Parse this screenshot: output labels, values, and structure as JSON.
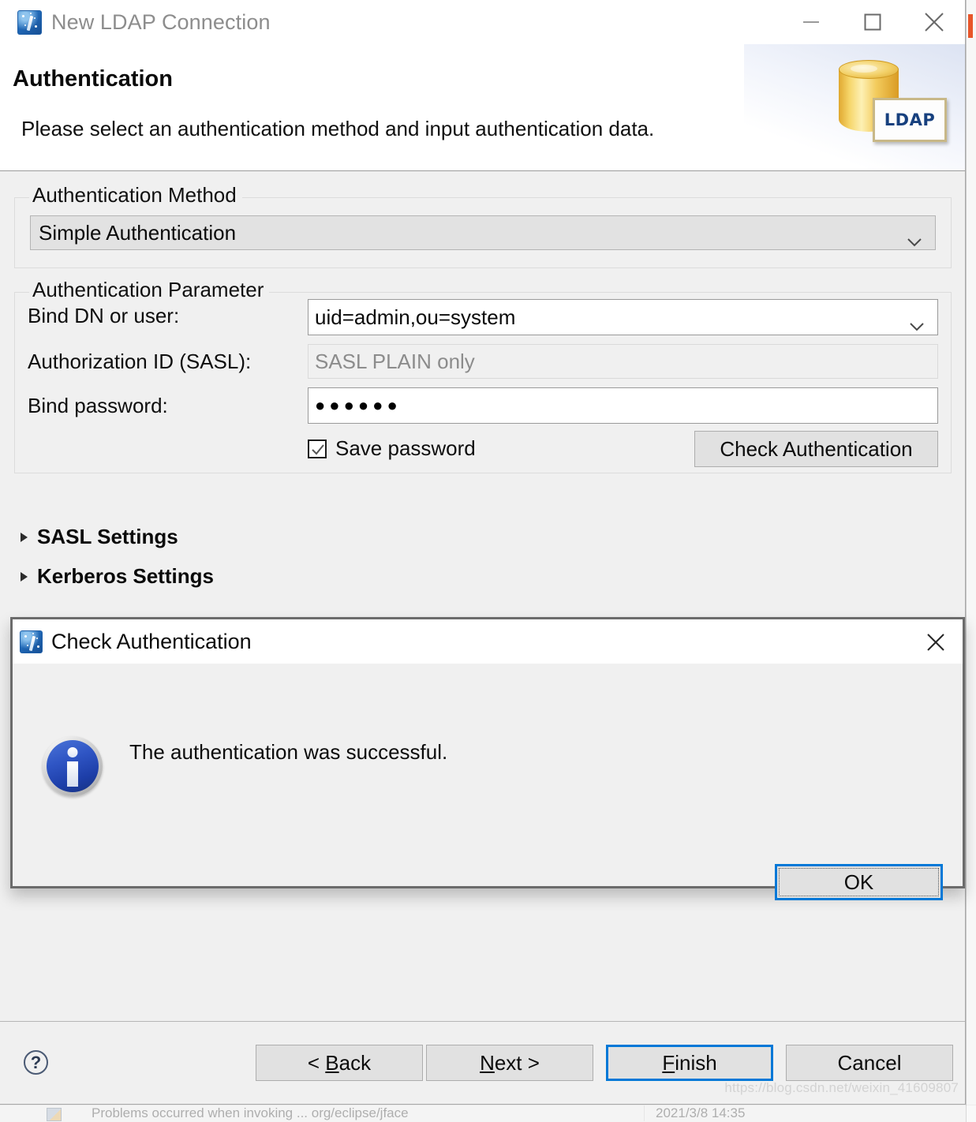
{
  "window": {
    "title": "New LDAP Connection",
    "app_icon": "ldap-wizard-icon",
    "minimize_label": "Minimize",
    "maximize_label": "Maximize",
    "close_label": "Close"
  },
  "header": {
    "title": "Authentication",
    "description": "Please select an authentication method and input authentication data.",
    "artwork_label": "LDAP"
  },
  "method_group": {
    "legend": "Authentication Method",
    "selected": "Simple Authentication"
  },
  "parameter_group": {
    "legend": "Authentication Parameter",
    "bind_dn_label": "Bind DN or user:",
    "bind_dn_value": "uid=admin,ou=system",
    "authz_id_label": "Authorization ID (SASL):",
    "authz_id_placeholder": "SASL PLAIN only",
    "bind_password_label": "Bind password:",
    "bind_password_value": "●●●●●●",
    "save_password_label": "Save password",
    "save_password_checked": "checked",
    "check_authentication_label": "Check Authentication"
  },
  "sections": [
    {
      "label": "SASL Settings",
      "expanded": "collapsed"
    },
    {
      "label": "Kerberos Settings",
      "expanded": "collapsed"
    }
  ],
  "dialog": {
    "title": "Check Authentication",
    "message": "The authentication was successful.",
    "icon": "info-icon",
    "ok_label": "OK",
    "close_label": "Close"
  },
  "footer": {
    "help_label": "?",
    "back_label": "< Back",
    "back_mnemonic": "B",
    "next_label": "Next >",
    "next_mnemonic": "N",
    "finish_label": "Finish",
    "finish_mnemonic": "F",
    "cancel_label": "Cancel"
  },
  "watermark": "https://blog.csdn.net/weixin_41609807",
  "background": {
    "row_col1": "",
    "row_col2": "Problems occurred when invoking ... org/eclipse/jface",
    "row_col3": "2021/3/8   14:35"
  },
  "colors": {
    "accent": "#0078d7",
    "window_bg": "#f0f0f0",
    "titlebar_bg": "#ffffff",
    "button_bg": "#e1e1e1",
    "info_blue": "#2f55c4",
    "ldap_yellow": "#f2cf65",
    "ldap_text": "#17407e"
  }
}
